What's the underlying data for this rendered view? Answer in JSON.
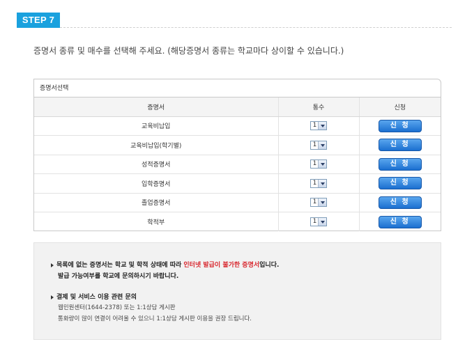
{
  "step": {
    "label": "STEP 7"
  },
  "instruction": "증명서 종류 및 매수를 선택해 주세요. (해당증명서 종류는 학교마다 상이할 수 있습니다.)",
  "panel": {
    "title": "증명서선택",
    "headers": {
      "name": "증명서",
      "qty": "통수",
      "apply": "신청"
    },
    "rows": [
      {
        "name": "교육비납입",
        "qty": "1",
        "apply": "신 청"
      },
      {
        "name": "교육비납입(학기별)",
        "qty": "1",
        "apply": "신 청"
      },
      {
        "name": "성적증명서",
        "qty": "1",
        "apply": "신 청"
      },
      {
        "name": "입학증명서",
        "qty": "1",
        "apply": "신 청"
      },
      {
        "name": "졸업증명서",
        "qty": "1",
        "apply": "신 청"
      },
      {
        "name": "학적부",
        "qty": "1",
        "apply": "신 청"
      }
    ]
  },
  "notice": {
    "line1_before": "목록에 없는 증명서는 학교 및 학적 상태에 따라 ",
    "line1_red": "인터넷 발급이 불가한 증명서",
    "line1_after": "입니다.",
    "line2": "발급 가능여부를 학교에 문의하시기 바랍니다.",
    "line3": "결제 및 서비스 이용 관련 문의",
    "line4": "웹민원센터(1644-2378) 또는 1:1상담 게시판",
    "line5": "통화량이 많이 연결이 어려울 수 있으니 1:1상담 게시판 이용을 권장 드립니다."
  },
  "colors": {
    "step_badge": "#1aa1de",
    "apply_button": "#1b6fd0",
    "notice_red": "#d8282f"
  }
}
